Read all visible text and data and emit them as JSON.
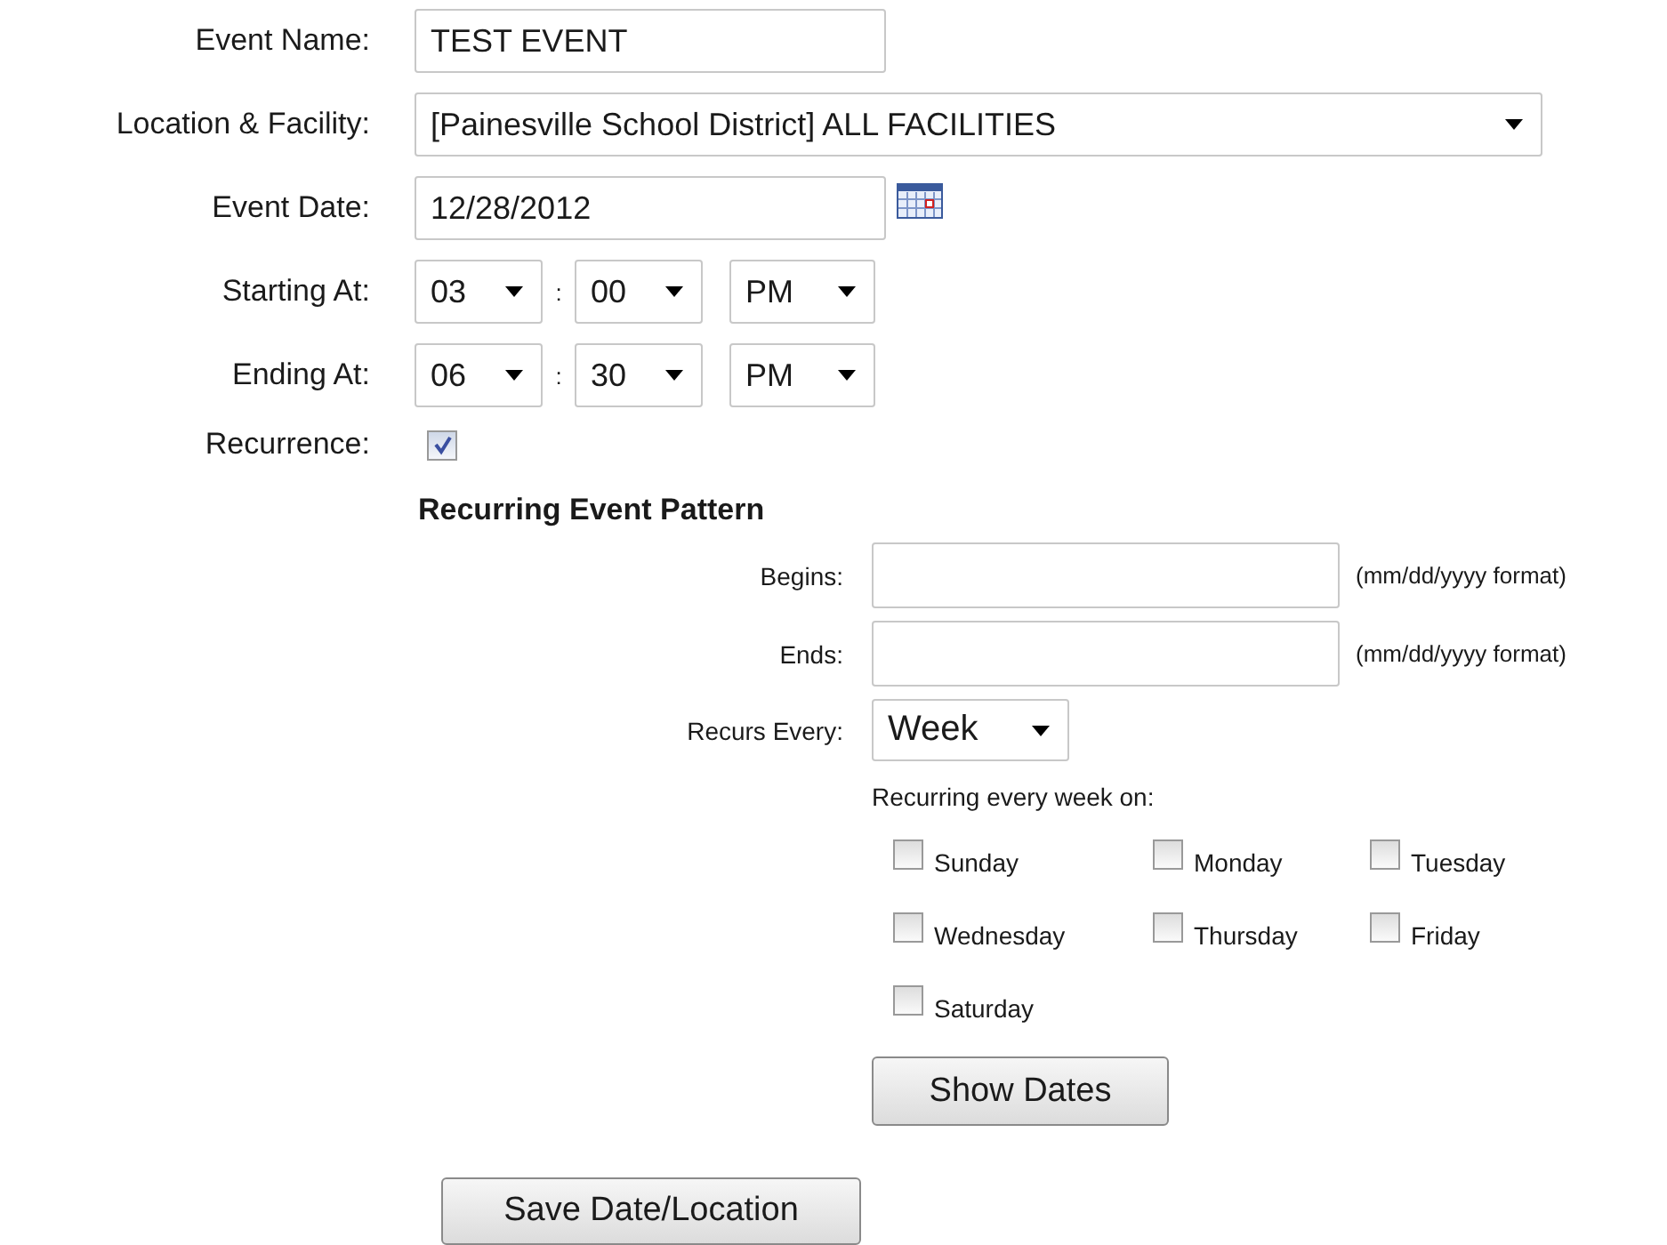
{
  "event_name": {
    "label": "Event Name:",
    "value": "TEST EVENT"
  },
  "location": {
    "label": "Location & Facility:",
    "value": "[Painesville School District] ALL FACILITIES"
  },
  "event_date": {
    "label": "Event Date:",
    "value": "12/28/2012"
  },
  "times": [
    {
      "label": "Starting At:",
      "hour": "03",
      "separator": ":",
      "minute": "00",
      "period": "PM"
    },
    {
      "label": "Ending At:",
      "hour": "06",
      "separator": ":",
      "minute": "30",
      "period": "PM"
    }
  ],
  "recurrence": {
    "label": "Recurrence:",
    "checked": true
  },
  "pattern": {
    "title": "Recurring Event Pattern",
    "dates": [
      {
        "label": "Begins:",
        "hint": "(mm/dd/yyyy format)"
      },
      {
        "label": "Ends:",
        "hint": "(mm/dd/yyyy format)"
      }
    ],
    "recurs_every": {
      "label": "Recurs Every:",
      "value": "Week"
    },
    "days_label": "Recurring every week on:",
    "days": [
      {
        "label": "Sunday",
        "checked": false
      },
      {
        "label": "Monday",
        "checked": false
      },
      {
        "label": "Tuesday",
        "checked": false
      },
      {
        "label": "Wednesday",
        "checked": false
      },
      {
        "label": "Thursday",
        "checked": false
      },
      {
        "label": "Friday",
        "checked": false
      },
      {
        "label": "Saturday",
        "checked": false
      }
    ],
    "show_dates_button": "Show Dates"
  },
  "save_button": "Save Date/Location"
}
